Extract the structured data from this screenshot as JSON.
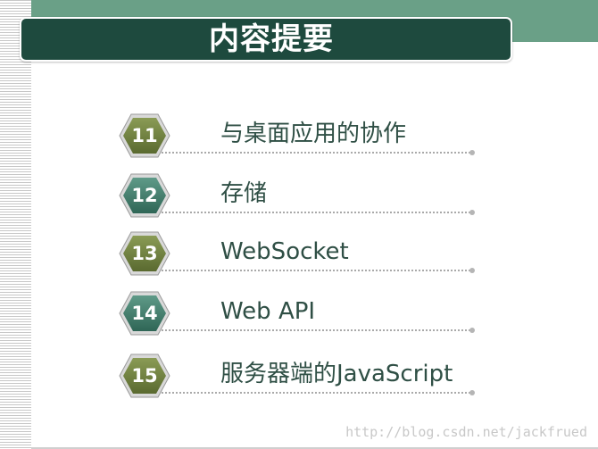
{
  "slide": {
    "title": "内容提要",
    "watermark": "http://blog.csdn.net/jackfrued"
  },
  "colors": {
    "title_bar": "#1e4a3e",
    "top_band": "#6aa087",
    "hex_olive": "#6b7f3f",
    "hex_teal": "#3f7a6a",
    "text": "#2f4f45"
  },
  "items": [
    {
      "number": "11",
      "label": "与桌面应用的协作",
      "style": "olive"
    },
    {
      "number": "12",
      "label": "存储",
      "style": "teal"
    },
    {
      "number": "13",
      "label": "WebSocket",
      "style": "olive"
    },
    {
      "number": "14",
      "label": "Web API",
      "style": "teal"
    },
    {
      "number": "15",
      "label": "服务器端的JavaScript",
      "style": "olive"
    }
  ]
}
